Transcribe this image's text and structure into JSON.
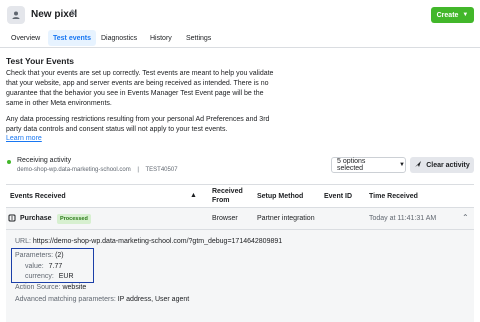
{
  "header": {
    "title": "New pixel",
    "create_label": "Create",
    "tabs": [
      {
        "label": "Overview",
        "active": false
      },
      {
        "label": "Test events",
        "active": true
      },
      {
        "label": "Diagnostics",
        "active": false
      },
      {
        "label": "History",
        "active": false
      },
      {
        "label": "Settings",
        "active": false
      }
    ]
  },
  "intro": {
    "title": "Test Your Events",
    "para1": "Check that your events are set up correctly. Test events are meant to help you validate that your website, app and server events are being received as intended. There is no guarantee that the behavior you see in Events Manager Test Event page will be the same in other Meta environments.",
    "para2": "Any data processing restrictions resulting from your personal Ad Preferences and 3rd party data controls and consent status will not apply to your test events.",
    "learn_more": "Learn more"
  },
  "activity": {
    "status": "Receiving activity",
    "site": "demo-shop-wp.data-marketing-school.com",
    "separator": "|",
    "test_code": "TEST40507",
    "options_label": "5 options selected",
    "clear_label": "Clear activity"
  },
  "table": {
    "headers": {
      "events": "Events Received",
      "received_from": "Received From",
      "setup": "Setup Method",
      "event_id": "Event ID",
      "time": "Time Received"
    },
    "row": {
      "event": "Purchase",
      "badge": "Processed",
      "received_from": "Browser",
      "setup": "Partner integration",
      "event_id": "",
      "time": "Today at 11:41:31 AM"
    }
  },
  "details": {
    "url_label": "URL:",
    "url_value": "https://demo-shop-wp.data-marketing-school.com/?gtm_debug=1714642809891",
    "params_label": "Parameters:",
    "params_count": "(2)",
    "value_label": "value:",
    "value_value": "7.77",
    "currency_label": "currency:",
    "currency_value": "EUR",
    "source_label": "Action Source:",
    "source_value": "website",
    "amp_label": "Advanced matching parameters:",
    "amp_value": "IP address, User agent"
  },
  "colors": {
    "accent": "#1877f2",
    "create_green": "#42b72a",
    "highlight_box": "#1b3fa8"
  }
}
